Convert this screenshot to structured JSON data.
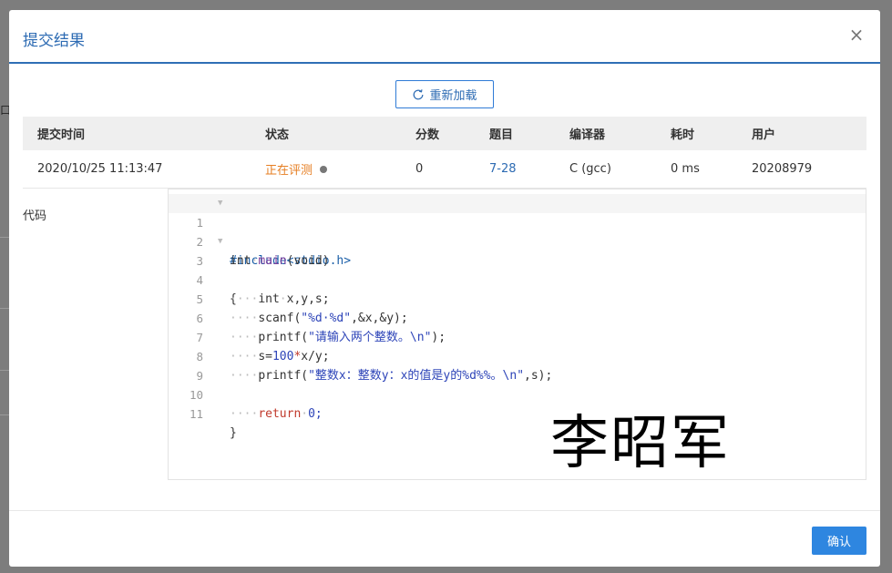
{
  "modal": {
    "title": "提交结果",
    "close_icon": "×",
    "reload_label": "重新加载",
    "confirm_label": "确认"
  },
  "background": {
    "edge_text": "口"
  },
  "table": {
    "headers": [
      "提交时间",
      "状态",
      "分数",
      "题目",
      "编译器",
      "耗时",
      "用户"
    ],
    "row": {
      "time": "2020/10/25 11:13:47",
      "status": "正在评测",
      "score": "0",
      "problem": "7-28",
      "compiler": "C (gcc)",
      "duration": "0 ms",
      "user": "20208979"
    }
  },
  "code_label": "代码",
  "code_lines": [
    "1",
    "2",
    "3",
    "4",
    "5",
    "6",
    "7",
    "8",
    "9",
    "10",
    "11"
  ],
  "code_text": {
    "l1": "#include<stdio.h>",
    "l2_kw": "int",
    "l2_fn": "main",
    "l2_rest": "(void)",
    "l3": "{",
    "l4_kw": "int",
    "l4_rest": "x,y,s;",
    "l5_fn": "scanf(",
    "l5_str": "\"%d·%d\"",
    "l5_rest": ",&x,&y);",
    "l6_fn": "printf(",
    "l6_str": "\"请输入两个整数。\\n\"",
    "l6_rest": ");",
    "l7_a": "s=",
    "l7_num": "100",
    "l7_op": "*",
    "l7_b": "x/y;",
    "l8_fn": "printf(",
    "l8_str": "\"整数x：整数y：x的值是y的%d%%。\\n\"",
    "l8_rest": ",s);",
    "l10_kw": "return",
    "l10_num": "0;",
    "l11": "}",
    "indent": "····"
  },
  "signature": "李昭军",
  "colors": {
    "accent": "#2d6bb3",
    "status": "#e67e22",
    "confirm_bg": "#2e86e0"
  }
}
